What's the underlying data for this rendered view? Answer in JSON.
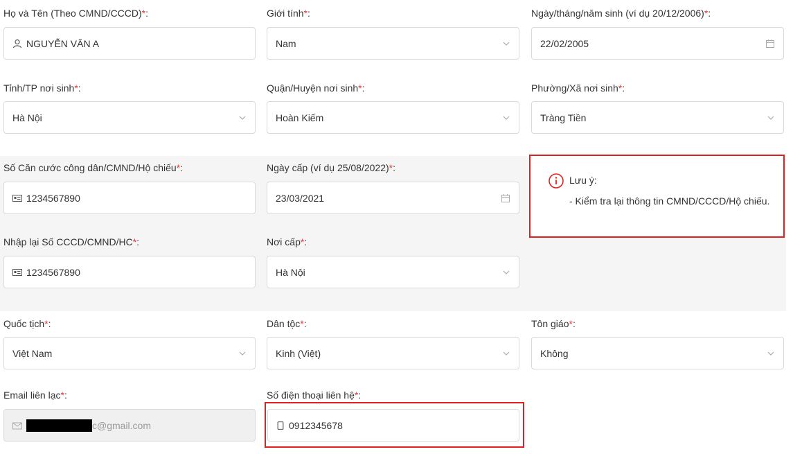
{
  "required_mark": "*",
  "labels": {
    "fullname": "Họ và Tên (Theo CMND/CCCD)",
    "gender": "Giới tính",
    "dob": "Ngày/tháng/năm sinh (ví dụ 20/12/2006)",
    "birth_province": "Tỉnh/TP nơi sinh",
    "birth_district": "Quận/Huyện nơi sinh",
    "birth_ward": "Phường/Xã nơi sinh",
    "id_number": "Số Căn cước công dân/CMND/Hộ chiếu",
    "issue_date": "Ngày cấp (ví dụ 25/08/2022)",
    "id_confirm": "Nhập lại Số CCCD/CMND/HC",
    "issue_place": "Nơi cấp",
    "nationality": "Quốc tịch",
    "ethnicity": "Dân tộc",
    "religion": "Tôn giáo",
    "email": "Email liên lạc",
    "phone": "Số điện thoại liên hệ"
  },
  "values": {
    "fullname": "NGUYỄN VĂN A",
    "gender": "Nam",
    "dob": "22/02/2005",
    "birth_province": "Hà Nội",
    "birth_district": "Hoàn Kiếm",
    "birth_ward": "Tràng Tiền",
    "id_number": "1234567890",
    "issue_date": "23/03/2021",
    "id_confirm": "1234567890",
    "issue_place": "Hà Nội",
    "nationality": "Việt Nam",
    "ethnicity": "Kinh (Việt)",
    "religion": "Không",
    "email_visible_suffix": "c@gmail.com",
    "phone": "0912345678"
  },
  "notice": {
    "title": "Lưu ý:",
    "body": "- Kiểm tra lại thông tin CMND/CCCD/Hộ chiếu."
  },
  "colors": {
    "required": "#e53935",
    "highlight_border": "#e1201e",
    "section_bg": "#f5f5f5"
  },
  "icons": {
    "fullname": "user-icon",
    "id": "id-card-icon",
    "email": "mail-icon",
    "phone": "phone-icon",
    "date": "calendar-icon",
    "select": "chevron-down-icon",
    "notice": "info-icon"
  }
}
